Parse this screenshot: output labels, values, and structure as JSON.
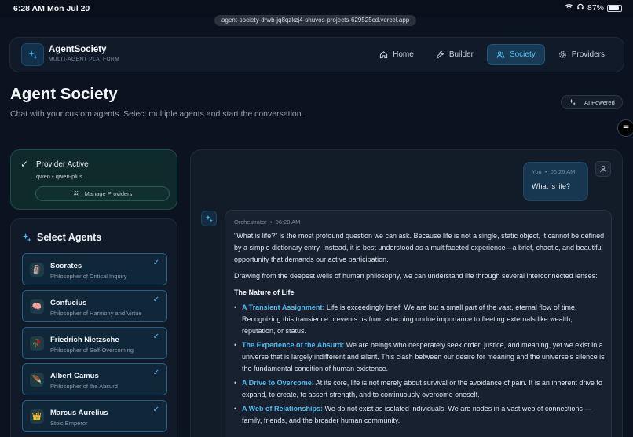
{
  "status_bar": {
    "time": "6:28 AM",
    "date": "Mon Jul 20",
    "battery": "87%"
  },
  "browser": {
    "url": "agent-society-drwb-jq8qzkzj4-shuvos-projects-629525cd.vercel.app"
  },
  "brand": {
    "name_a": "Agent",
    "name_b": "Society",
    "tagline": "MULTI-AGENT PLATFORM"
  },
  "nav": [
    {
      "label": "Home",
      "icon": "home-icon"
    },
    {
      "label": "Builder",
      "icon": "wrench-icon"
    },
    {
      "label": "Society",
      "icon": "users-icon",
      "active": true
    },
    {
      "label": "Providers",
      "icon": "gear-icon"
    }
  ],
  "header": {
    "title": "Agent Society",
    "subtitle": "Chat with your custom agents. Select multiple agents and start the conversation.",
    "badge": "AI Powered"
  },
  "provider": {
    "title": "Provider Active",
    "meta": "qwen • qwen-plus",
    "manage_label": "Manage Providers"
  },
  "agents": {
    "heading": "Select Agents",
    "items": [
      {
        "name": "Socrates",
        "desc": "Philosopher of Critical Inquiry",
        "icon": "🗿"
      },
      {
        "name": "Confucius",
        "desc": "Philosopher of Harmony and Virtue",
        "icon": "🧠"
      },
      {
        "name": "Friedrich Nietzsche",
        "desc": "Philosopher of Self-Overcoming",
        "icon": "🥀"
      },
      {
        "name": "Albert Camus",
        "desc": "Philosopher of the Absurd",
        "icon": "🪶"
      },
      {
        "name": "Marcus Aurelius",
        "desc": "Stoic Emperor",
        "icon": "👑"
      }
    ]
  },
  "chat": {
    "user": {
      "who": "You",
      "time": "06:26 AM",
      "text": "What is life?"
    },
    "bot": {
      "who": "Orchestrator",
      "time": "06:28 AM",
      "p1": "\"What is life?\" is the most profound question we can ask. Because life is not a single, static object, it cannot be defined by a simple dictionary entry. Instead, it is best understood as a multifaceted experience—a brief, chaotic, and beautiful opportunity that demands our active participation.",
      "p2": "Drawing from the deepest wells of human philosophy, we can understand life through several interconnected lenses:",
      "heading": "The Nature of Life",
      "bullets": [
        {
          "kw": "A Transient Assignment:",
          "text": " Life is exceedingly brief. We are but a small part of the vast, eternal flow of time. Recognizing this transience prevents us from attaching undue importance to fleeting externals like wealth, reputation, or status."
        },
        {
          "kw": "The Experience of the Absurd:",
          "text": " We are beings who desperately seek order, justice, and meaning, yet we exist in a universe that is largely indifferent and silent. This clash between our desire for meaning and the universe's silence is the fundamental condition of human existence."
        },
        {
          "kw": "A Drive to Overcome:",
          "text": " At its core, life is not merely about survival or the avoidance of pain. It is an inherent drive to expand, to create, to assert strength, and to continuously overcome oneself."
        },
        {
          "kw": "A Web of Relationships:",
          "text": " We do not exist as isolated individuals. We are nodes in a vast web of connections —family, friends, and the broader human community."
        }
      ]
    }
  }
}
